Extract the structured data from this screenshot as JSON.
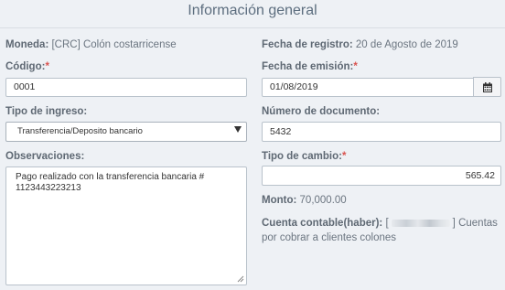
{
  "header": {
    "title": "Información general"
  },
  "form": {
    "moneda": {
      "label": "Moneda:",
      "value": "[CRC] Colón costarricense"
    },
    "fecha_registro": {
      "label": "Fecha de registro:",
      "value": "20 de Agosto de 2019"
    },
    "codigo": {
      "label": "Código:",
      "required_mark": "*",
      "value": "0001"
    },
    "fecha_emision": {
      "label": "Fecha de emisión:",
      "required_mark": "*",
      "value": "01/08/2019",
      "icon": "calendar-icon"
    },
    "tipo_ingreso": {
      "label": "Tipo de ingreso:",
      "selected": "Transferencia/Deposito bancario"
    },
    "numero_documento": {
      "label": "Número de documento:",
      "value": "5432"
    },
    "observaciones": {
      "label": "Observaciones:",
      "value": "Pago realizado con la transferencia bancaria # 1123443223213"
    },
    "tipo_cambio": {
      "label": "Tipo de cambio:",
      "required_mark": "*",
      "value": "565.42"
    },
    "monto": {
      "label": "Monto:",
      "value": "70,000.00"
    },
    "cuenta_contable": {
      "label": "Cuenta contable(haber):",
      "open_bracket": "[",
      "close_bracket": "]",
      "description": "Cuentas por cobrar a clientes colones"
    }
  },
  "colors": {
    "required": "#d9534f",
    "label": "#5e6873",
    "title": "#5d6e7f"
  }
}
